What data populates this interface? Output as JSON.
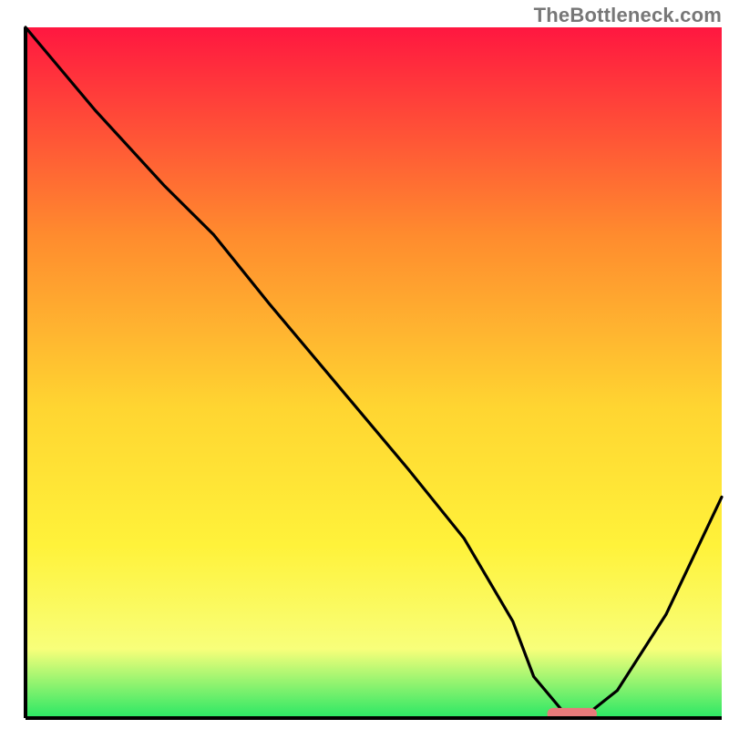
{
  "watermark": "TheBottleneck.com",
  "chart_data": {
    "type": "line",
    "title": "",
    "xlabel": "",
    "ylabel": "",
    "xlim": [
      0,
      100
    ],
    "ylim": [
      0,
      100
    ],
    "grid": false,
    "legend": false,
    "background_gradient": {
      "top": "#ff1740",
      "upper_mid": "#ff8b2e",
      "mid": "#ffd531",
      "lower_mid": "#fff23a",
      "lower": "#f8ff7a",
      "bottom": "#29e765"
    },
    "series": [
      {
        "name": "bottleneck-curve",
        "color": "#000000",
        "x": [
          0,
          10,
          20,
          27,
          35,
          45,
          55,
          63,
          70,
          73,
          78,
          80,
          85,
          92,
          100
        ],
        "y": [
          100,
          88,
          77,
          70,
          60,
          48,
          36,
          26,
          14,
          6,
          0,
          0,
          4,
          15,
          32
        ]
      }
    ],
    "marker": {
      "name": "optimal-zone",
      "color_fill": "#e77a7a",
      "color_stroke": "#e77a7a",
      "x_start": 75,
      "x_end": 82,
      "y": 0.6,
      "height": 1.6,
      "radius": 1.0
    },
    "axes": {
      "x": {
        "visible": true,
        "position": "bottom"
      },
      "y": {
        "visible": true,
        "position": "left"
      }
    }
  }
}
